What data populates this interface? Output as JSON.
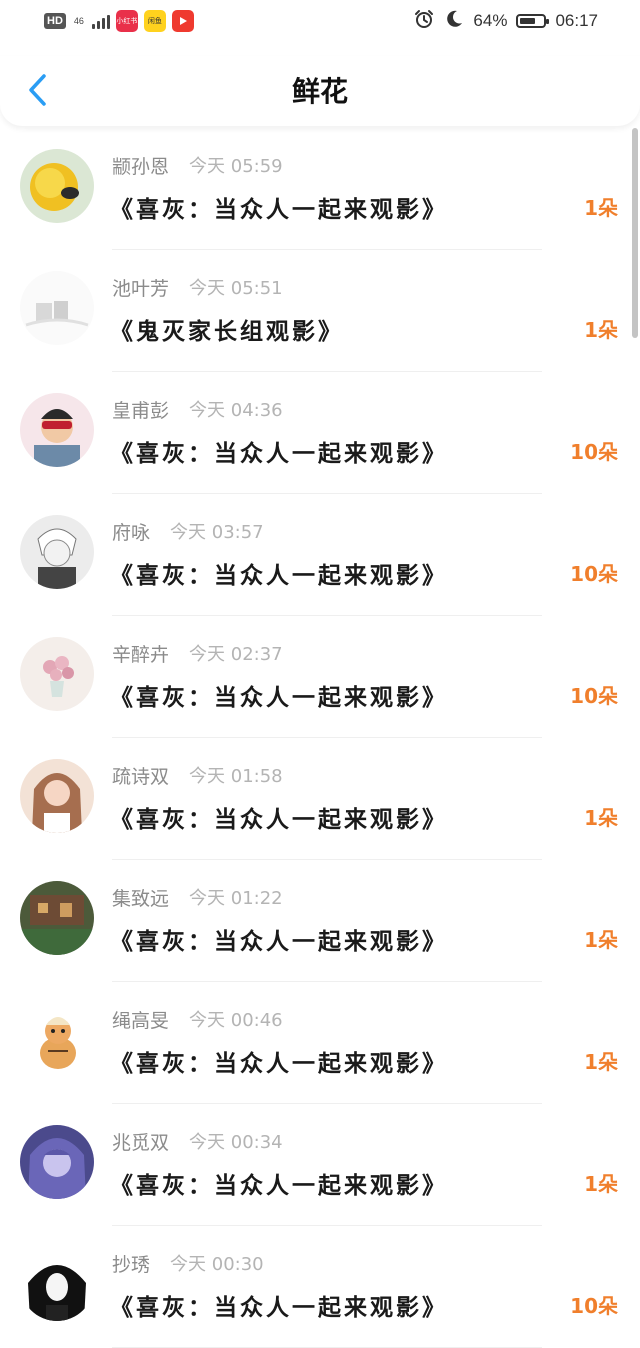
{
  "status_bar": {
    "hd": "HD",
    "network": "46",
    "apps": [
      {
        "label": "小红书",
        "icon": "xiaohongshu-app-icon"
      },
      {
        "label": "闲鱼",
        "icon": "xianyu-app-icon"
      },
      {
        "label": "",
        "icon": "video-app-icon"
      }
    ],
    "alarm_icon": "alarm-clock-icon",
    "dnd_icon": "moon-icon",
    "battery_percent": 64,
    "battery_text": "64%",
    "time": "06:17"
  },
  "header": {
    "back_icon": "chevron-left-icon",
    "title": "鲜花"
  },
  "colors": {
    "accent_blue": "#2a9df4",
    "count_orange": "#f07f2c",
    "sender_gray": "#8b8b8b",
    "time_gray": "#b4b4b4"
  },
  "items": [
    {
      "sender": "颛孙恩",
      "time": "今天 05:59",
      "title": "《喜灰：当众人一起来观影》",
      "count": "1朵"
    },
    {
      "sender": "池叶芳",
      "time": "今天 05:51",
      "title": "《鬼灭家长组观影》",
      "count": "1朵"
    },
    {
      "sender": "皇甫彭",
      "time": "今天 04:36",
      "title": "《喜灰：当众人一起来观影》",
      "count": "10朵"
    },
    {
      "sender": "府咏",
      "time": "今天 03:57",
      "title": "《喜灰：当众人一起来观影》",
      "count": "10朵"
    },
    {
      "sender": "辛醉卉",
      "time": "今天 02:37",
      "title": "《喜灰：当众人一起来观影》",
      "count": "10朵"
    },
    {
      "sender": "疏诗双",
      "time": "今天 01:58",
      "title": "《喜灰：当众人一起来观影》",
      "count": "1朵"
    },
    {
      "sender": "集致远",
      "time": "今天 01:22",
      "title": "《喜灰：当众人一起来观影》",
      "count": "1朵"
    },
    {
      "sender": "绳高旻",
      "time": "今天 00:46",
      "title": "《喜灰：当众人一起来观影》",
      "count": "1朵"
    },
    {
      "sender": "兆觅双",
      "time": "今天 00:34",
      "title": "《喜灰：当众人一起来观影》",
      "count": "1朵"
    },
    {
      "sender": "抄琇",
      "time": "今天 00:30",
      "title": "《喜灰：当众人一起来观影》",
      "count": "10朵"
    }
  ]
}
